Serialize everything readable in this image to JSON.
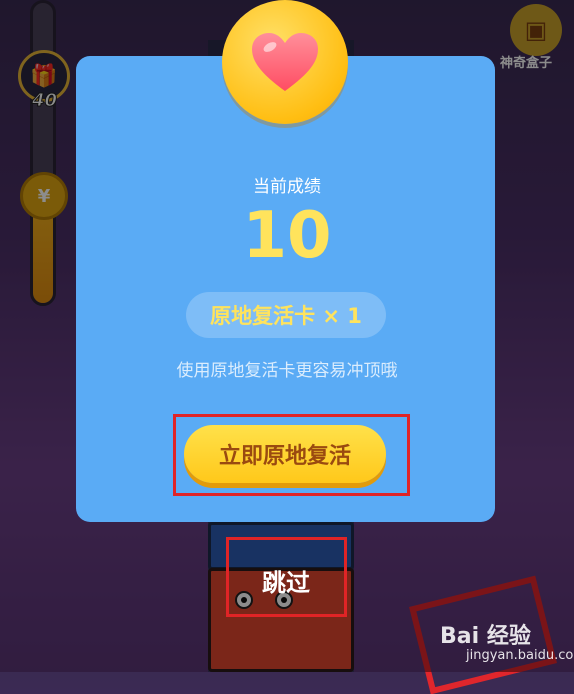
{
  "hud": {
    "gift_count": "40",
    "magic_box_label": "神奇盒子"
  },
  "dialog": {
    "score_label": "当前成绩",
    "score_value": "10",
    "revive_card": "原地复活卡 × 1",
    "hint": "使用原地复活卡更容易冲顶哦",
    "revive_button_label": "立即原地复活",
    "skip_button_label": "跳过"
  },
  "watermark": {
    "logo_text": "Bai 经验",
    "url": "jingyan.baidu.com"
  },
  "colors": {
    "dialog_bg": "#5aabf5",
    "score_yellow": "#ffe35c",
    "button_yellow": "#ffc81a",
    "highlight_red": "#e02426"
  },
  "icons": {
    "heart": "heart-icon",
    "gift": "gift-icon",
    "coin": "coin-icon",
    "hand": "hand-icon",
    "magic_box": "magic-box-icon"
  }
}
